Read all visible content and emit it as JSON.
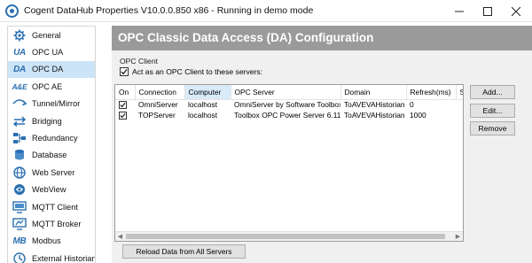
{
  "window": {
    "title": "Cogent DataHub Properties V10.0.0.850 x86 - Running in demo mode"
  },
  "sidebar": {
    "items": [
      {
        "label": "General",
        "icon": "gear-icon"
      },
      {
        "label": "OPC UA",
        "icon": "ua-text-icon",
        "icon_text": "UA"
      },
      {
        "label": "OPC DA",
        "icon": "da-text-icon",
        "icon_text": "DA",
        "selected": true
      },
      {
        "label": "OPC AE",
        "icon": "ae-text-icon",
        "icon_text": "A&E"
      },
      {
        "label": "Tunnel/Mirror",
        "icon": "tunnel-arrow-icon"
      },
      {
        "label": "Bridging",
        "icon": "bridge-arrows-icon"
      },
      {
        "label": "Redundancy",
        "icon": "redundancy-icon"
      },
      {
        "label": "Database",
        "icon": "database-icon"
      },
      {
        "label": "Web Server",
        "icon": "globe-icon"
      },
      {
        "label": "WebView",
        "icon": "webview-icon"
      },
      {
        "label": "MQTT Client",
        "icon": "mqtt-client-icon"
      },
      {
        "label": "MQTT Broker",
        "icon": "mqtt-broker-icon"
      },
      {
        "label": "Modbus",
        "icon": "mb-text-icon",
        "icon_text": "MB"
      },
      {
        "label": "External Historian",
        "icon": "historian-icon"
      }
    ]
  },
  "main": {
    "header_title": "OPC Classic Data Access (DA) Configuration",
    "group_label": "OPC Client",
    "act_as_client_label": "Act as an OPC Client to these servers:",
    "act_as_client_checked": true,
    "table": {
      "columns": [
        "On",
        "Connection",
        "Computer",
        "OPC Server",
        "Domain",
        "Refresh(ms)",
        "S"
      ],
      "rows": [
        {
          "on": true,
          "connection": "OmniServer",
          "computer": "localhost",
          "opc_server": "OmniServer by Software Toolbox",
          "domain": "ToAVEVAHistorian",
          "refresh": "0"
        },
        {
          "on": true,
          "connection": "TOPServer",
          "computer": "localhost",
          "opc_server": "Toolbox OPC Power Server 6.11",
          "domain": "ToAVEVAHistorian",
          "refresh": "1000"
        }
      ]
    },
    "buttons": {
      "add": "Add...",
      "edit": "Edit...",
      "remove": "Remove",
      "reload": "Reload Data from All Servers"
    }
  },
  "colors": {
    "header_band": "#9a9a9a",
    "selected_nav": "#cce4f7",
    "accent_icon": "#2a6fb0"
  }
}
